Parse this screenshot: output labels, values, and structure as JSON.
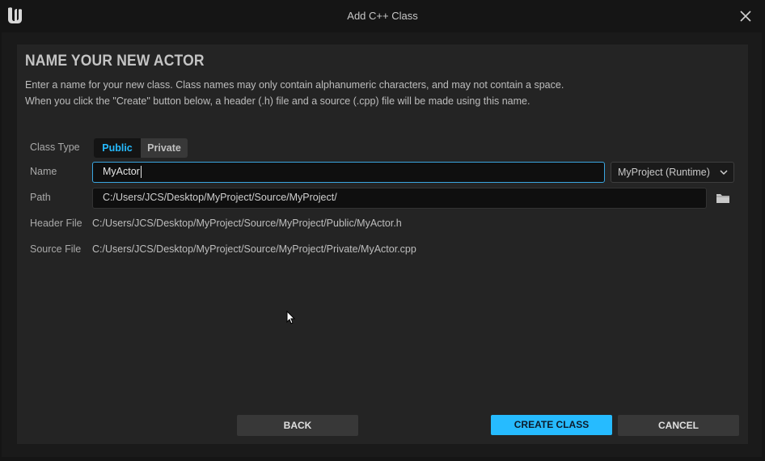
{
  "window": {
    "title": "Add C++ Class",
    "logo_icon": "unreal-engine-logo-icon",
    "close_icon": "close-icon"
  },
  "content": {
    "heading": "NAME YOUR NEW ACTOR",
    "description_line1": "Enter a name for your new class. Class names may only contain alphanumeric characters, and may not contain a space.",
    "description_line2": "When you click the \"Create\" button below, a header (.h) file and a source (.cpp) file will be made using this name."
  },
  "form": {
    "class_type_label": "Class Type",
    "class_type_options": [
      "Public",
      "Private"
    ],
    "class_type_selected": "Public",
    "name_label": "Name",
    "name_value": "MyActor",
    "module_selected": "MyProject (Runtime)",
    "path_label": "Path",
    "path_value": "C:/Users/JCS/Desktop/MyProject/Source/MyProject/",
    "header_file_label": "Header File",
    "header_file_value": "C:/Users/JCS/Desktop/MyProject/Source/MyProject/Public/MyActor.h",
    "source_file_label": "Source File",
    "source_file_value": "C:/Users/JCS/Desktop/MyProject/Source/MyProject/Private/MyActor.cpp"
  },
  "buttons": {
    "back": "BACK",
    "create": "CREATE CLASS",
    "cancel": "CANCEL"
  },
  "colors": {
    "accent": "#26bbff",
    "background": "#151515",
    "panel": "#242424"
  }
}
